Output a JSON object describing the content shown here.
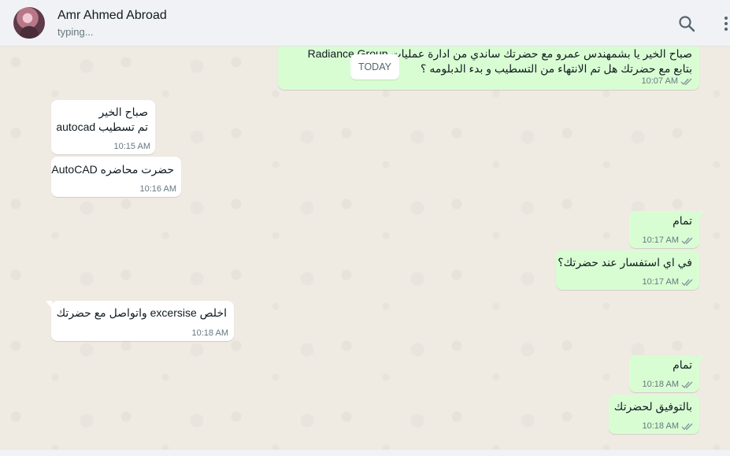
{
  "header": {
    "contact_name": "Amr Ahmed Abroad",
    "status": "typing...",
    "icons": [
      "search-icon",
      "menu-icon"
    ]
  },
  "date_divider": "TODAY",
  "messages": [
    {
      "dir": "out",
      "lines": [
        "صباح الخير يا بشمهندس عمرو مع حضرتك ساندي من ادارة عمليات Radiance Group",
        "بتابع مع حضرتك هل تم الانتهاء من التسطيب و بدء الدبلومه ؟"
      ],
      "time": "10:07 AM",
      "ticks": "read"
    },
    {
      "dir": "in",
      "lines": [
        "صباح الخير",
        "تم تسطيب autocad"
      ],
      "time": "10:15 AM"
    },
    {
      "dir": "in",
      "lines": [
        "حضرت محاضره AutoCAD"
      ],
      "time": "10:16 AM"
    },
    {
      "dir": "out",
      "lines": [
        "تمام"
      ],
      "time": "10:17 AM",
      "ticks": "read"
    },
    {
      "dir": "out",
      "lines": [
        "في اي استفسار عند حضرتك؟"
      ],
      "time": "10:17 AM",
      "ticks": "read"
    },
    {
      "dir": "in",
      "lines": [
        "اخلص excersise واتواصل مع حضرتك"
      ],
      "time": "10:18 AM"
    },
    {
      "dir": "out",
      "lines": [
        "تمام"
      ],
      "time": "10:18 AM",
      "ticks": "read"
    },
    {
      "dir": "out",
      "lines": [
        "بالتوفيق لحضرتك"
      ],
      "time": "10:18 AM",
      "ticks": "read"
    }
  ],
  "colors": {
    "outgoing_bubble": "#d9fdd3",
    "incoming_bubble": "#ffffff",
    "chat_background": "#efeae2",
    "header_background": "#f0f2f5",
    "read_ticks": "#8696a0"
  }
}
